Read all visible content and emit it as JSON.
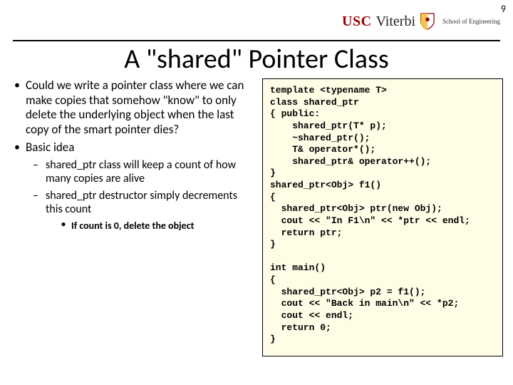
{
  "page_number": "9",
  "logo": {
    "usc": "USC",
    "viterbi": "Viterbi",
    "sub": "School of Engineering"
  },
  "title": "A \"shared\" Pointer Class",
  "bullets": {
    "item1": "Could we write a pointer class where we can make copies that somehow \"know\" to only delete the underlying object when the last copy of the smart pointer dies?",
    "item2": "Basic idea",
    "sub1": "shared_ptr class will keep a count of how many copies are alive",
    "sub2": "shared_ptr destructor simply decrements this count",
    "subsub1": "If count is 0, delete the object"
  },
  "code": "template <typename T>\nclass shared_ptr\n{ public:\n    shared_ptr(T* p);\n    ~shared_ptr();\n    T& operator*();\n    shared_ptr& operator++();\n}\nshared_ptr<Obj> f1()\n{\n  shared_ptr<Obj> ptr(new Obj);\n  cout << \"In F1\\n\" << *ptr << endl;\n  return ptr;\n}\n\nint main()\n{\n  shared_ptr<Obj> p2 = f1();\n  cout << \"Back in main\\n\" << *p2;\n  cout << endl;\n  return 0;\n}"
}
